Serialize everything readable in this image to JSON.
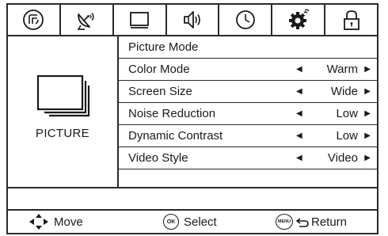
{
  "tabs": [
    {
      "icon": "picture-signal-icon"
    },
    {
      "icon": "satellite-dish-icon"
    },
    {
      "icon": "picture-icon"
    },
    {
      "icon": "speaker-icon"
    },
    {
      "icon": "clock-icon"
    },
    {
      "icon": "gear-icon"
    },
    {
      "icon": "lock-icon"
    }
  ],
  "category": {
    "label": "PICTURE",
    "icon": "picture-icon"
  },
  "rows": [
    {
      "label": "Picture Mode",
      "value": ""
    },
    {
      "label": "Color Mode",
      "value": "Warm"
    },
    {
      "label": "Screen Size",
      "value": "Wide"
    },
    {
      "label": "Noise Reduction",
      "value": "Low"
    },
    {
      "label": "Dynamic Contrast",
      "value": "Low"
    },
    {
      "label": "Video Style",
      "value": "Video"
    }
  ],
  "arrows": {
    "left": "◀",
    "right": "▶"
  },
  "footer": {
    "move_label": "Move",
    "select_label": "Select",
    "select_button": "OK",
    "return_label": "Return",
    "return_button": "MENU"
  }
}
